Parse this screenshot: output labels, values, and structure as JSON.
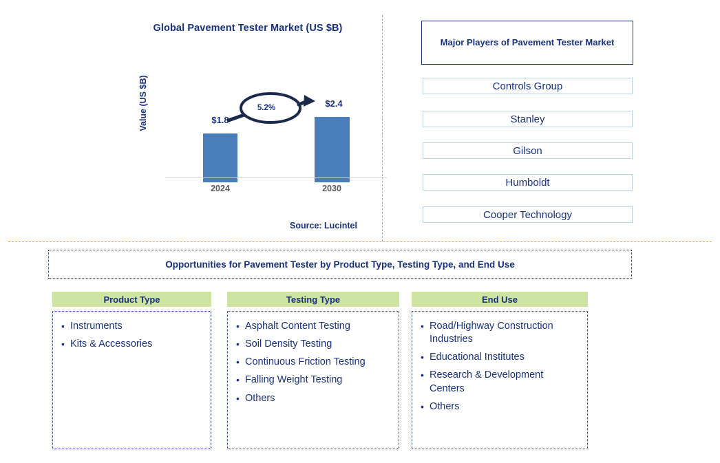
{
  "chart_data": {
    "type": "bar",
    "title": "Global Pavement Tester Market (US $B)",
    "xlabel": "",
    "ylabel": "Value (US $B)",
    "categories": [
      "2024",
      "2030"
    ],
    "values": [
      1.8,
      2.4
    ],
    "value_labels": [
      "$1.8",
      "$2.4"
    ],
    "ylim": [
      0,
      2.7
    ],
    "grid": false,
    "legend": "none",
    "bar_color": "#4a7ebb",
    "annotation": {
      "label": "5.2%",
      "type": "cagr-ellipse-arrow",
      "from": "2024",
      "to": "2030"
    },
    "source": "Source: Lucintel"
  },
  "chart_panel": {
    "title": "Global Pavement Tester Market (US $B)",
    "y_axis_label": "Value (US $B)",
    "cagr": "5.2%",
    "bars": [
      {
        "year": "2024",
        "value_label": "$1.8"
      },
      {
        "year": "2030",
        "value_label": "$2.4"
      }
    ],
    "source": "Source: Lucintel"
  },
  "players_panel": {
    "title": "Major Players of Pavement Tester Market",
    "items": [
      {
        "label": "Controls Group"
      },
      {
        "label": "Stanley"
      },
      {
        "label": "Gilson"
      },
      {
        "label": "Humboldt"
      },
      {
        "label": "Cooper Technology"
      }
    ]
  },
  "opportunities": {
    "banner": "Opportunities for Pavement Tester by Product Type, Testing Type, and End Use",
    "columns": [
      {
        "header": "Product Type",
        "items": [
          "Instruments",
          "Kits & Accessories"
        ]
      },
      {
        "header": "Testing Type",
        "items": [
          "Asphalt Content Testing",
          "Soil Density Testing",
          "Continuous Friction Testing",
          "Falling Weight Testing",
          "Others"
        ]
      },
      {
        "header": "End Use",
        "items": [
          "Road/Highway Construction Industries",
          "Educational Institutes",
          "Research & Development Centers",
          "Others"
        ]
      }
    ]
  },
  "colors": {
    "brand_navy": "#17317f",
    "bar_blue": "#4a7ebb",
    "header_green": "#cfe3a3",
    "divider_orange": "#f0a500",
    "player_border": "#b9d3ea",
    "tick_gray": "#595959"
  }
}
